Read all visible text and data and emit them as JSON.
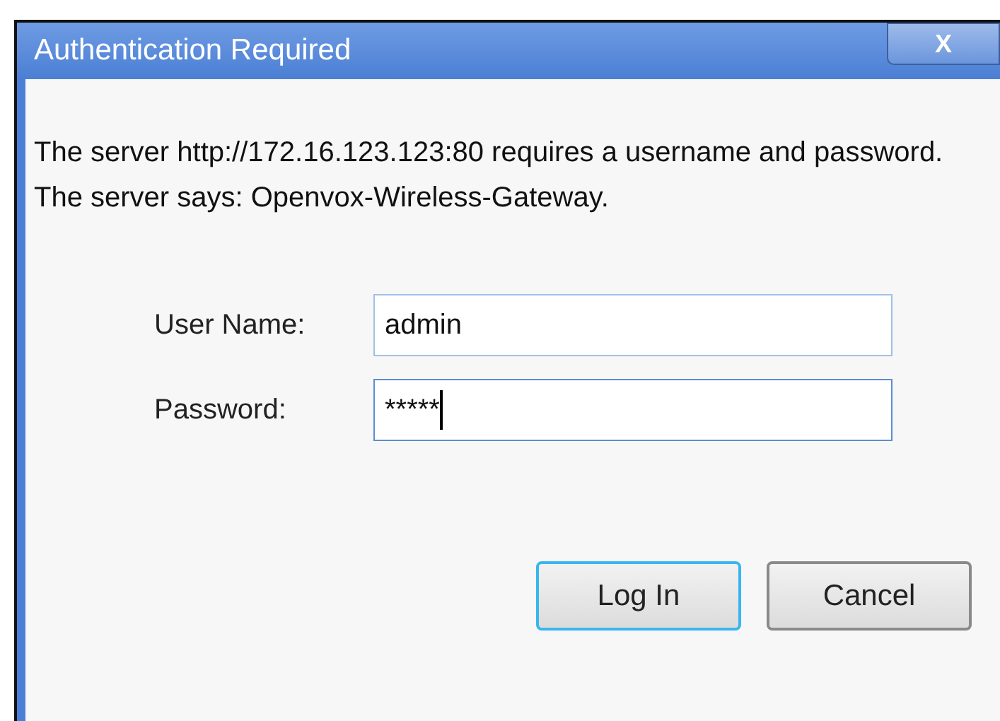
{
  "window": {
    "title": "Authentication Required",
    "close_label": "X"
  },
  "message": "The server http://172.16.123.123:80 requires a username and password. The server says: Openvox-Wireless-Gateway.",
  "fields": [
    {
      "label": "User Name:",
      "value": "admin",
      "focused": false
    },
    {
      "label": "Password:",
      "value": "*****",
      "focused": true
    }
  ],
  "buttons": [
    {
      "label": "Log In",
      "default": true
    },
    {
      "label": "Cancel",
      "default": false
    }
  ]
}
